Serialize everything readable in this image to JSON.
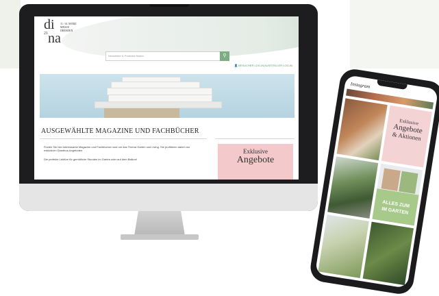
{
  "website": {
    "logo": {
      "top": "di",
      "bottom": "na",
      "sup": "21",
      "tiny": "11.-14. MÄRZ MESSE DRESDEN"
    },
    "search": {
      "placeholder": "Newsletter & Produkte finden"
    },
    "login": {
      "visitor": "BESUCHER LOG-IN",
      "exhibitor": "AUSSTELLER LOG-IN"
    },
    "headline": "AUSGEWÄHLTE MAGAZINE UND FACHBÜCHER",
    "paragraph1": "Finden Sie hier interessante Magazine und Fachbücher rund um das Thema Garten und Living. Sie profitieren dabei von exklusiven Dianthus-Angeboten.",
    "paragraph2": "Die perfekte Lektüre für gemütliche Stunden im Garten oder auf dem Balkon!",
    "promo": {
      "line1": "Exklusive",
      "line2": "Angebote"
    }
  },
  "phone": {
    "app_title": "Instagram",
    "promo1": {
      "line1": "Exklusive",
      "line2": "Angebote",
      "line3": "& Aktionen"
    },
    "promo2": {
      "line1": "ALLES ZUM",
      "line2": "IM GARTEN"
    }
  },
  "colors": {
    "accent_green": "#7cad83",
    "promo_pink": "#f3c9cc",
    "device_black": "#1d1d1f"
  }
}
